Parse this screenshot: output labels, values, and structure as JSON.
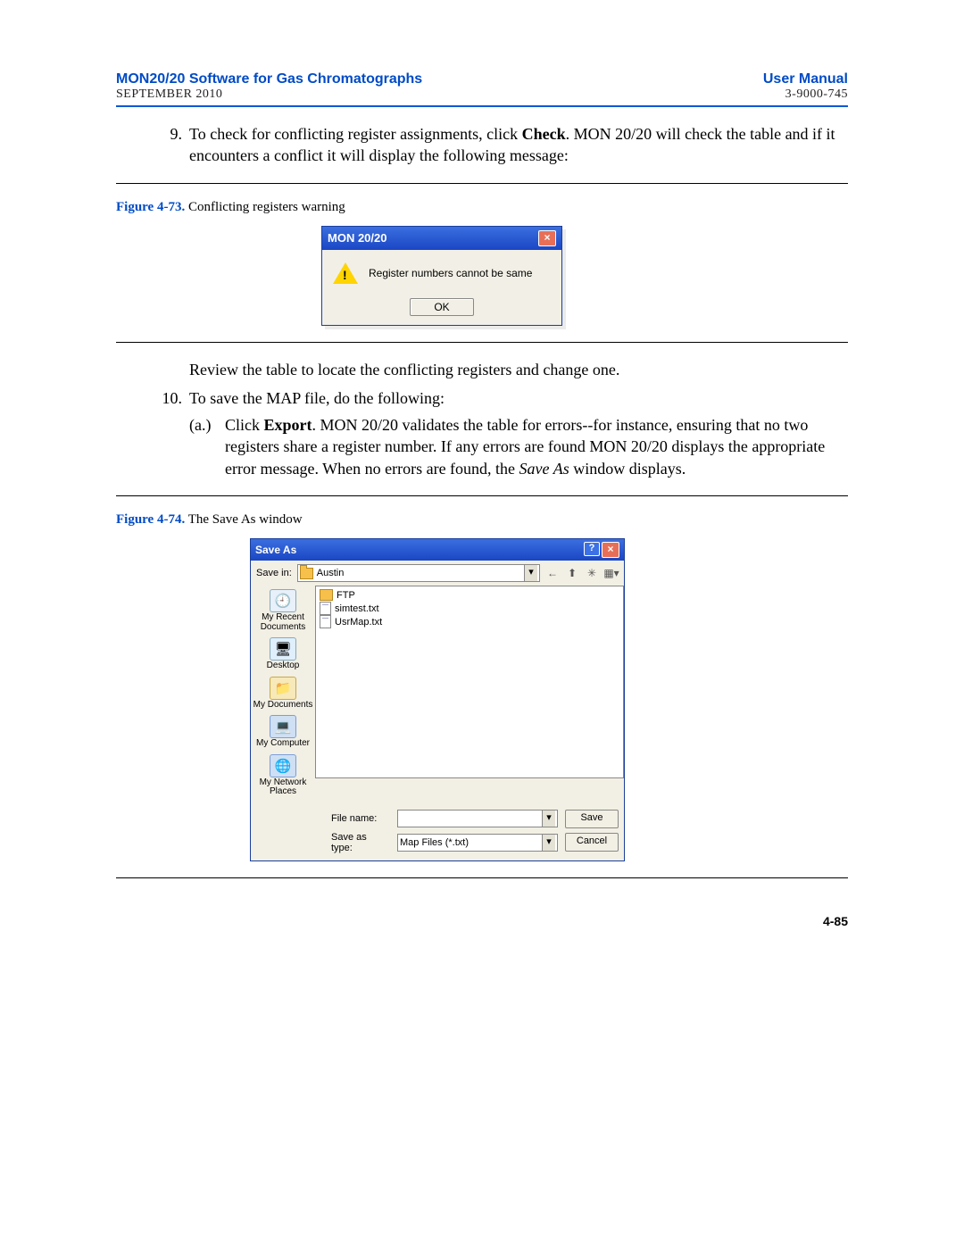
{
  "header": {
    "title_left": "MON20/20 Software for Gas Chromatographs",
    "title_right": "User Manual",
    "sub_left": "SEPTEMBER 2010",
    "sub_right": "3-9000-745"
  },
  "step9": {
    "num": "9.",
    "pre": "To check for conflicting register assignments, click ",
    "bold": "Check",
    "post": ".  MON 20/20 will check the table and if it encounters a conflict it will display the following message:"
  },
  "fig73": {
    "label": "Figure 4-73.",
    "caption": "  Conflicting registers warning"
  },
  "dlg1": {
    "title": "MON 20/20",
    "msg": "Register numbers cannot be same",
    "ok": "OK"
  },
  "review_line": "Review the table to locate the conflicting registers and change one.",
  "step10": {
    "num": "10.",
    "text": "To save the MAP file, do the following:"
  },
  "step10a": {
    "num": "(a.)",
    "t1": "Click ",
    "bold": "Export",
    "t2": ".   MON 20/20 validates the table for errors--for instance, ensuring that no two registers share a register number. If any errors are found MON 20/20 displays the appropriate error message.  When no errors are found, the ",
    "italic": "Save As",
    "t3": " window displays."
  },
  "fig74": {
    "label": "Figure 4-74.",
    "caption": "  The Save As window"
  },
  "saveas": {
    "title": "Save As",
    "save_in_label": "Save in:",
    "save_in_value": "Austin",
    "files": [
      "FTP",
      "simtest.txt",
      "UsrMap.txt"
    ],
    "places": {
      "recent": "My Recent Documents",
      "desktop": "Desktop",
      "mydocs": "My Documents",
      "mycomp": "My Computer",
      "mynet": "My Network Places"
    },
    "file_name_label": "File name:",
    "file_name_value": "",
    "save_type_label": "Save as type:",
    "save_type_value": "Map Files (*.txt)",
    "save_btn": "Save",
    "cancel_btn": "Cancel"
  },
  "page_num": "4-85"
}
